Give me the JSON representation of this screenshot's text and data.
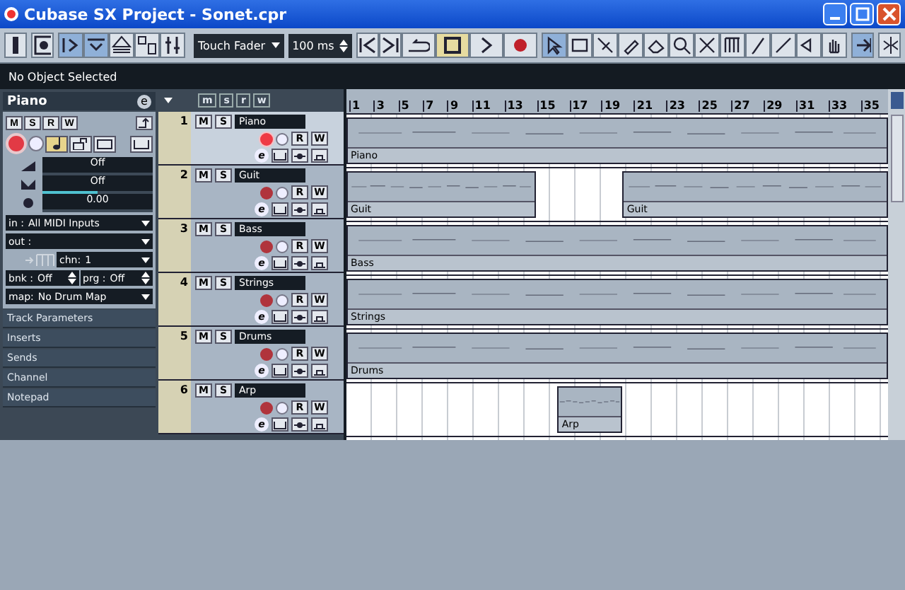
{
  "window": {
    "title": "Cubase SX Project - Sonet.cpr"
  },
  "toolbar": {
    "automation_mode": "Touch Fader",
    "preroll": "100 ms",
    "tools": [
      {
        "selected": true
      },
      {
        "selected": false
      },
      {
        "selected": false
      },
      {
        "selected": false
      },
      {
        "selected": false
      },
      {
        "selected": false
      },
      {
        "selected": false
      },
      {
        "selected": false
      },
      {
        "selected": false
      },
      {
        "selected": false
      },
      {
        "selected": false
      },
      {
        "selected": false
      }
    ]
  },
  "info_line": "No Object Selected",
  "inspector": {
    "track_name": "Piano",
    "edit_button": "e",
    "buttons": [
      "M",
      "S",
      "R",
      "W"
    ],
    "record_enabled": true,
    "volume": "Off",
    "pan": {
      "value": "Off",
      "level": 0.5
    },
    "delay": "0.00",
    "input_label": "in :",
    "input": "All MIDI Inputs",
    "output_label": "out :",
    "channel_label": "chn:",
    "channel": "1",
    "bank_label": "bnk :",
    "bank": "Off",
    "program_label": "prg :",
    "program": "Off",
    "map_label": "map:",
    "map": "No Drum Map",
    "sections": [
      "Track Parameters",
      "Inserts",
      "Sends",
      "Channel",
      "Notepad"
    ]
  },
  "track_list": {
    "header_buttons": [
      "m",
      "s",
      "r",
      "w"
    ],
    "tracks": [
      {
        "number": "1",
        "name": "Piano",
        "selected": true,
        "record_enabled": true,
        "buttons": [
          "M",
          "S",
          "R",
          "W",
          "e"
        ]
      },
      {
        "number": "2",
        "name": "Guit",
        "selected": false,
        "record_enabled": false,
        "buttons": [
          "M",
          "S",
          "R",
          "W",
          "e"
        ]
      },
      {
        "number": "3",
        "name": "Bass",
        "selected": false,
        "record_enabled": false,
        "buttons": [
          "M",
          "S",
          "R",
          "W",
          "e"
        ]
      },
      {
        "number": "4",
        "name": "Strings",
        "selected": false,
        "record_enabled": false,
        "buttons": [
          "M",
          "S",
          "R",
          "W",
          "e"
        ]
      },
      {
        "number": "5",
        "name": "Drums",
        "selected": false,
        "record_enabled": false,
        "buttons": [
          "M",
          "S",
          "R",
          "W",
          "e"
        ]
      },
      {
        "number": "6",
        "name": "Arp",
        "selected": false,
        "record_enabled": false,
        "buttons": [
          "M",
          "S",
          "R",
          "W",
          "e"
        ]
      }
    ]
  },
  "ruler": [
    "1",
    "3",
    "5",
    "7",
    "9",
    "11",
    "13",
    "15",
    "17",
    "19",
    "21",
    "23",
    "25",
    "27",
    "29",
    "31",
    "33",
    "35"
  ],
  "lanes": [
    {
      "parts": [
        "Piano"
      ]
    },
    {
      "parts": [
        "Guit",
        "Guit"
      ]
    },
    {
      "parts": [
        "Bass"
      ]
    },
    {
      "parts": [
        "Strings"
      ]
    },
    {
      "parts": [
        "Drums"
      ]
    },
    {
      "parts": [
        "Arp"
      ]
    }
  ]
}
